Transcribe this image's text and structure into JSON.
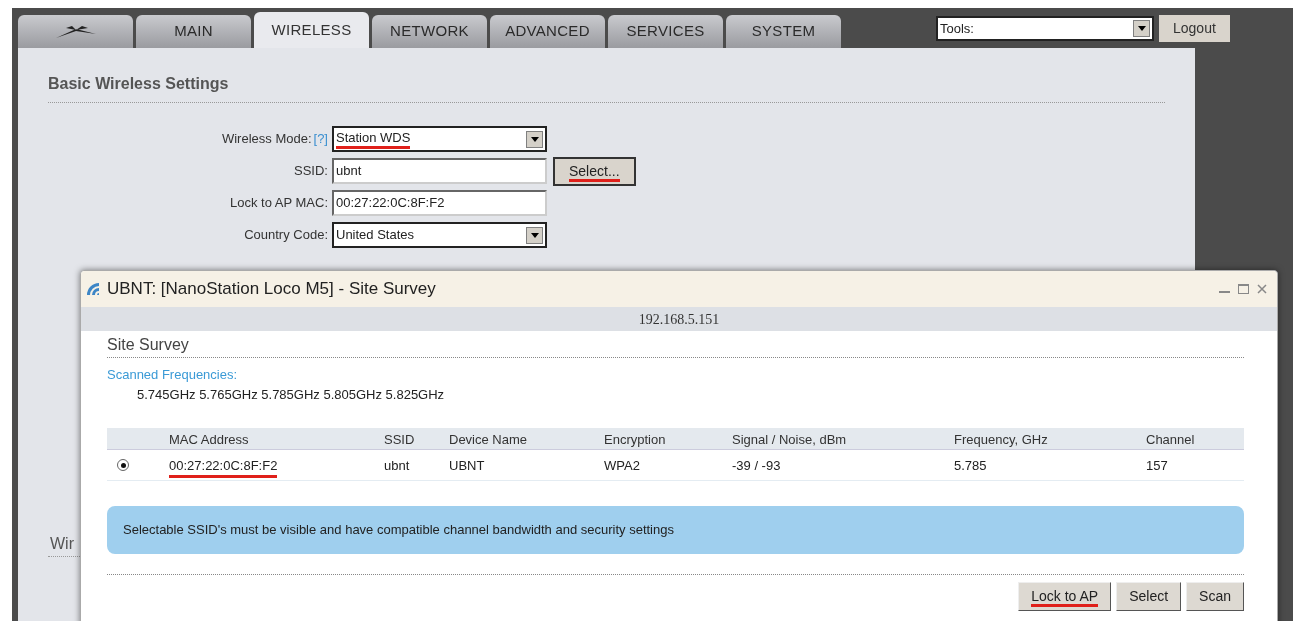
{
  "tabs": [
    {
      "kind": "logo",
      "selected": false
    },
    {
      "label": "MAIN",
      "selected": false
    },
    {
      "label": "WIRELESS",
      "selected": true
    },
    {
      "label": "NETWORK",
      "selected": false
    },
    {
      "label": "ADVANCED",
      "selected": false
    },
    {
      "label": "SERVICES",
      "selected": false
    },
    {
      "label": "SYSTEM",
      "selected": false
    }
  ],
  "tools": {
    "value": "Tools:"
  },
  "logout": "Logout",
  "section_title": "Basic Wireless Settings",
  "help_link": "[?]",
  "form": [
    {
      "label": "Wireless Mode:",
      "kind": "select",
      "value": "Station WDS",
      "highlighted": true
    },
    {
      "label": "SSID:",
      "kind": "text",
      "value": "ubnt",
      "highlighted": false,
      "button": "Select...",
      "button_highlighted": true
    },
    {
      "label": "Lock to AP MAC:",
      "kind": "text",
      "value": "00:27:22:0C:8F:F2",
      "highlighted": false
    },
    {
      "label": "Country Code:",
      "kind": "select",
      "value": "United States",
      "highlighted": false
    }
  ],
  "cut_heading": "Wir",
  "dialog": {
    "title": "UBNT: [NanoStation Loco M5] - Site Survey",
    "address": "192.168.5.151",
    "heading": "Site Survey",
    "freq_label": "Scanned Frequencies:",
    "frequencies": "5.745GHz 5.765GHz 5.785GHz 5.805GHz 5.825GHz",
    "columns": [
      "MAC Address",
      "SSID",
      "Device Name",
      "Encryption",
      "Signal / Noise, dBm",
      "Frequency, GHz",
      "Channel"
    ],
    "rows": [
      {
        "selected": true,
        "highlighted": true,
        "cells": [
          "00:27:22:0C:8F:F2",
          "ubnt",
          "UBNT",
          "WPA2",
          "-39 / -93",
          "5.785",
          "157"
        ]
      }
    ],
    "notice": "Selectable SSID's must be visible and have compatible channel bandwidth and security settings",
    "buttons": [
      {
        "label": "Lock to AP",
        "highlighted": true
      },
      {
        "label": "Select",
        "highlighted": false
      },
      {
        "label": "Scan",
        "highlighted": false
      }
    ]
  }
}
